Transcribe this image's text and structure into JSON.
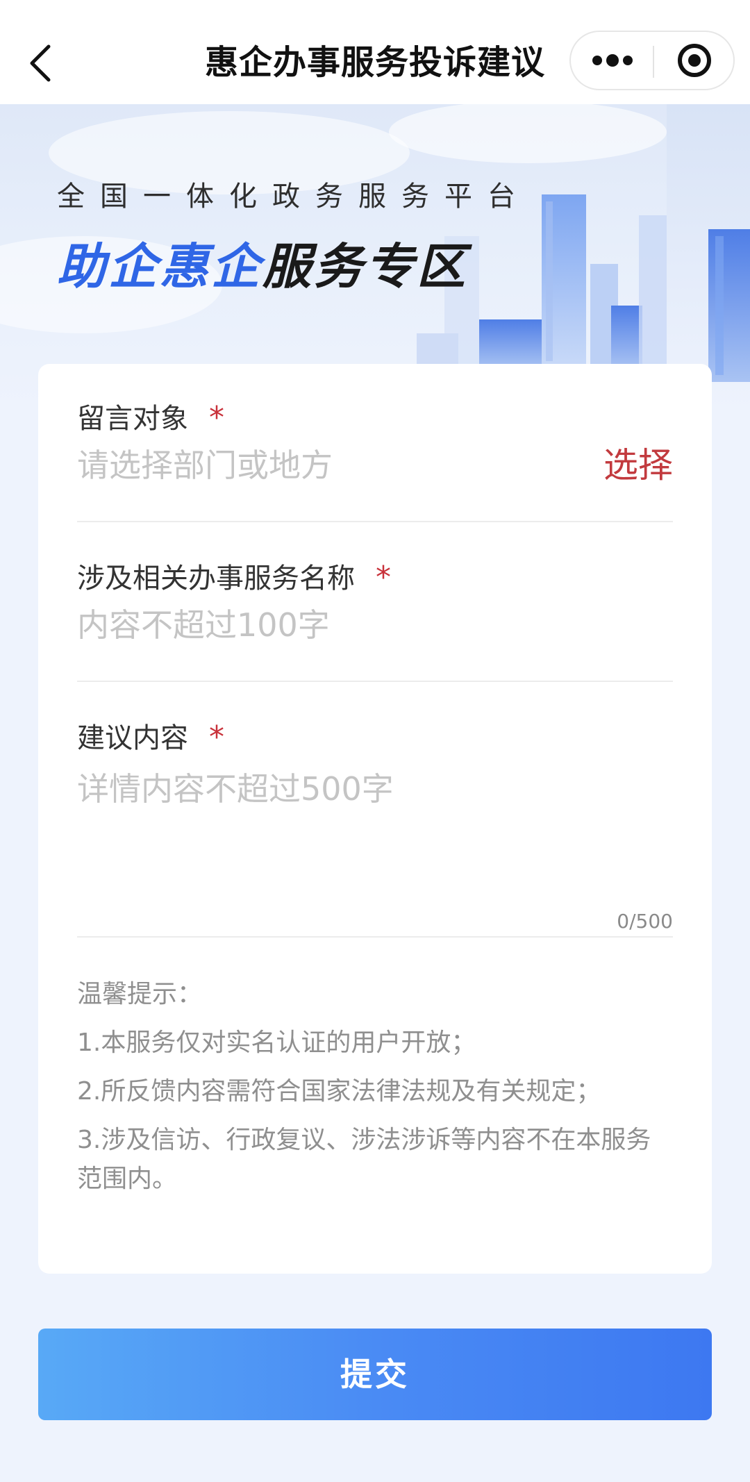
{
  "nav": {
    "title": "惠企办事服务投诉建议",
    "back_icon": "chevron-left-icon",
    "more_icon": "more-dots-icon",
    "mini_program_icon": "target-circle-icon"
  },
  "banner": {
    "subtitle": "全国一体化政务服务平台",
    "title_highlight": "助企惠企",
    "title_rest": "服务专区"
  },
  "form": {
    "target": {
      "label": "留言对象",
      "required_mark": "*",
      "placeholder": "请选择部门或地方",
      "select_label": "选择"
    },
    "service_name": {
      "label": "涉及相关办事服务名称",
      "required_mark": "*",
      "placeholder": "内容不超过100字"
    },
    "content": {
      "label": "建议内容",
      "required_mark": "*",
      "placeholder": "详情内容不超过500字",
      "counter": "0/500"
    }
  },
  "tips": {
    "title": "温馨提示：",
    "items": [
      "1.本服务仅对实名认证的用户开放；",
      "2.所反馈内容需符合国家法律法规及有关规定；",
      "3.涉及信访、行政复议、涉法涉诉等内容不在本服务范围内。"
    ]
  },
  "submit": {
    "label": "提交"
  },
  "colors": {
    "accent_blue": "#3d78f1",
    "required_red": "#c8313a",
    "select_red": "#c23a3e",
    "page_bg": "#eef3fd"
  }
}
